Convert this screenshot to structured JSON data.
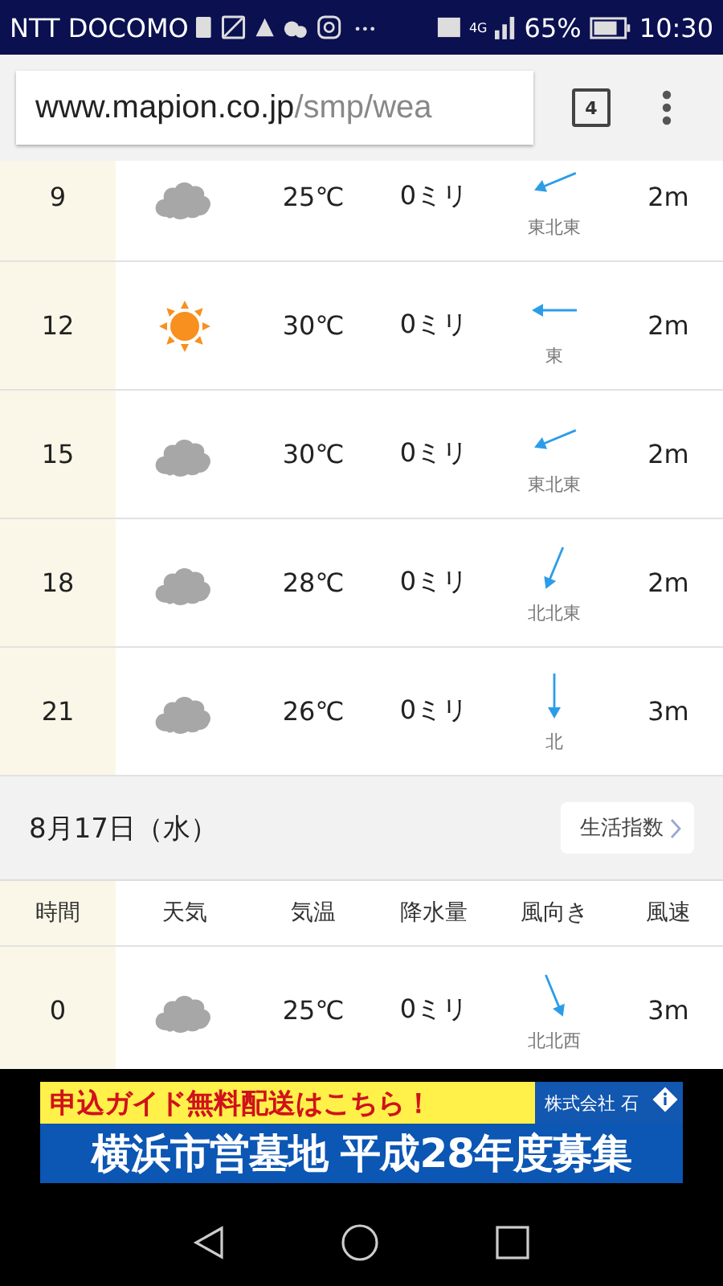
{
  "status_bar": {
    "carrier": "NTT DOCOMO",
    "network": "4G",
    "battery": "65%",
    "time": "10:30"
  },
  "browser": {
    "url_host": "www.mapion.co.jp",
    "url_path": "/smp/wea",
    "tab_count": "4"
  },
  "forecast_rows": [
    {
      "time": "9",
      "kind": "cloudy",
      "temp": "25℃",
      "rain": "0ミリ",
      "wind": {
        "kind": "ene",
        "label": "東北東"
      },
      "speed": "2m"
    },
    {
      "time": "12",
      "kind": "sunny",
      "temp": "30℃",
      "rain": "0ミリ",
      "wind": {
        "kind": "e",
        "label": "東"
      },
      "speed": "2m"
    },
    {
      "time": "15",
      "kind": "cloudy",
      "temp": "30℃",
      "rain": "0ミリ",
      "wind": {
        "kind": "ene",
        "label": "東北東"
      },
      "speed": "2m"
    },
    {
      "time": "18",
      "kind": "cloudy",
      "temp": "28℃",
      "rain": "0ミリ",
      "wind": {
        "kind": "nne",
        "label": "北北東"
      },
      "speed": "2m"
    },
    {
      "time": "21",
      "kind": "cloudy",
      "temp": "26℃",
      "rain": "0ミリ",
      "wind": {
        "kind": "n",
        "label": "北"
      },
      "speed": "3m"
    }
  ],
  "day_header": {
    "date": "8月17日（水）",
    "link": "生活指数"
  },
  "columns": [
    "時間",
    "天気",
    "気温",
    "降水量",
    "風向き",
    "風速"
  ],
  "next_day_rows": [
    {
      "time": "0",
      "kind": "cloudy",
      "temp": "25℃",
      "rain": "0ミリ",
      "wind": {
        "kind": "nnw",
        "label": "北北西"
      },
      "speed": "3m"
    }
  ],
  "ad": {
    "tagline": "申込ガイド無料配送はこちら！",
    "company": "株式会社 石",
    "headline": "横浜市営墓地 平成28年度募集"
  }
}
